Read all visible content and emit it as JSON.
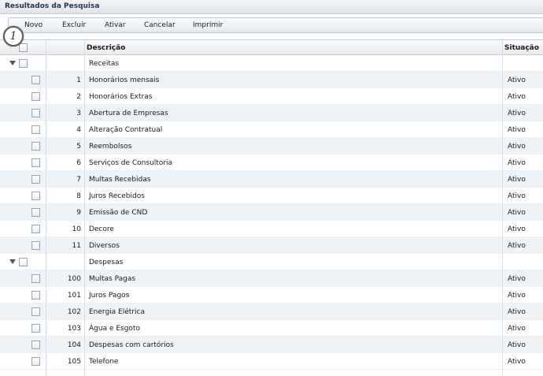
{
  "window": {
    "title": "Resultados da Pesquisa"
  },
  "toolbar": {
    "buttons": [
      {
        "label": "Novo",
        "name": "novo-button"
      },
      {
        "label": "Excluir",
        "name": "excluir-button"
      },
      {
        "label": "Ativar",
        "name": "ativar-button"
      },
      {
        "label": "Cancelar",
        "name": "cancelar-button"
      },
      {
        "label": "Imprimir",
        "name": "imprimir-button"
      }
    ]
  },
  "callout": {
    "number": "1"
  },
  "table": {
    "columns": {
      "descricao": "Descrição",
      "situacao": "Situação"
    },
    "groups": [
      {
        "label": "Receitas",
        "items": [
          {
            "code": "1",
            "desc": "Honorários mensais",
            "status": "Ativo"
          },
          {
            "code": "2",
            "desc": "Honorários Extras",
            "status": "Ativo"
          },
          {
            "code": "3",
            "desc": "Abertura de Empresas",
            "status": "Ativo"
          },
          {
            "code": "4",
            "desc": "Alteração Contratual",
            "status": "Ativo"
          },
          {
            "code": "5",
            "desc": "Reembolsos",
            "status": "Ativo"
          },
          {
            "code": "6",
            "desc": "Serviços de Consultoria",
            "status": "Ativo"
          },
          {
            "code": "7",
            "desc": "Multas Recebidas",
            "status": "Ativo"
          },
          {
            "code": "8",
            "desc": "Juros Recebidos",
            "status": "Ativo"
          },
          {
            "code": "9",
            "desc": "Emissão de CND",
            "status": "Ativo"
          },
          {
            "code": "10",
            "desc": "Decore",
            "status": "Ativo"
          },
          {
            "code": "11",
            "desc": "Diversos",
            "status": "Ativo"
          }
        ]
      },
      {
        "label": "Despesas",
        "items": [
          {
            "code": "100",
            "desc": "Multas Pagas",
            "status": "Ativo"
          },
          {
            "code": "101",
            "desc": "Juros Pagos",
            "status": "Ativo"
          },
          {
            "code": "102",
            "desc": "Energia Elétrica",
            "status": "Ativo"
          },
          {
            "code": "103",
            "desc": "Água e Esgoto",
            "status": "Ativo"
          },
          {
            "code": "104",
            "desc": "Despesas com cartórios",
            "status": "Ativo"
          },
          {
            "code": "105",
            "desc": "Telefone",
            "status": "Ativo"
          }
        ]
      }
    ]
  }
}
